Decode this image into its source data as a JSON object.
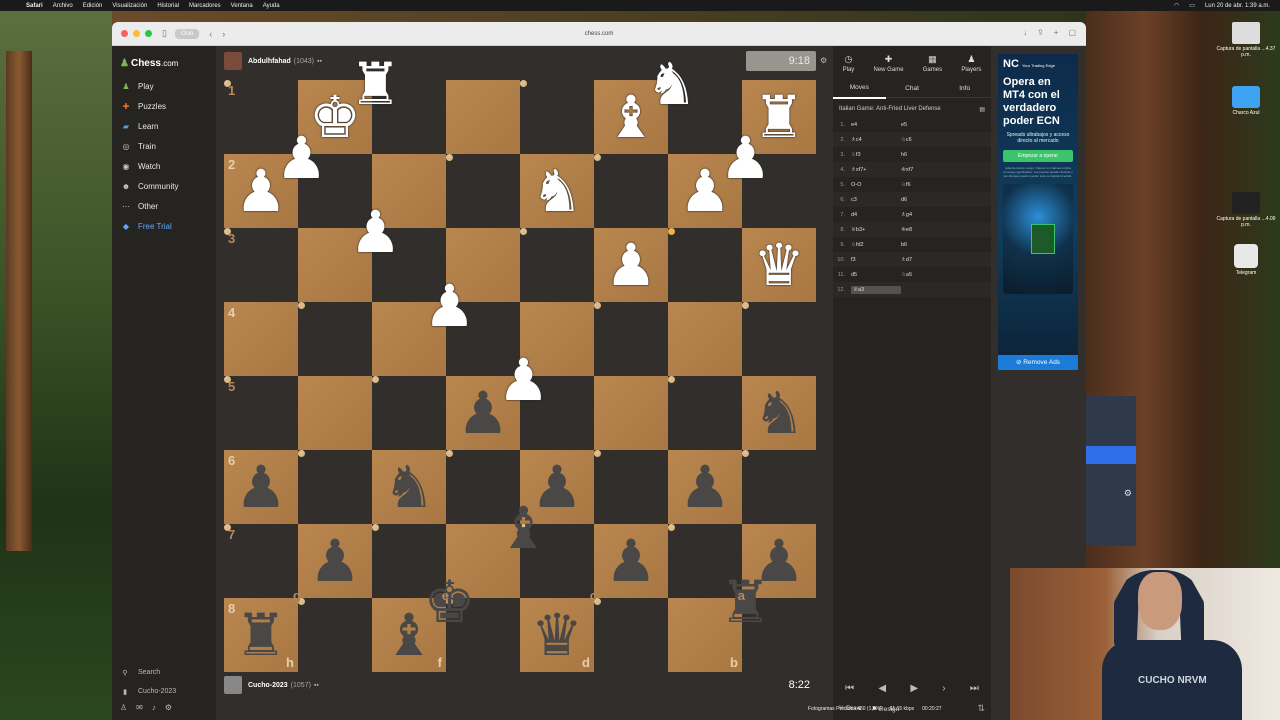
{
  "menubar": {
    "items": [
      "Safari",
      "Archivo",
      "Edición",
      "Visualización",
      "Historial",
      "Marcadores",
      "Ventana",
      "Ayuda"
    ],
    "clock": "Lun 20 de abr. 1:39 a.m."
  },
  "browser": {
    "tab_label": "Ocio",
    "url": "chess.com"
  },
  "sidebar": {
    "logo_main": "Chess",
    "logo_suffix": ".com",
    "items": [
      {
        "label": "Play",
        "icon": "play-icon"
      },
      {
        "label": "Puzzles",
        "icon": "puzzle-icon"
      },
      {
        "label": "Learn",
        "icon": "learn-icon"
      },
      {
        "label": "Train",
        "icon": "train-icon"
      },
      {
        "label": "Watch",
        "icon": "watch-icon"
      },
      {
        "label": "Community",
        "icon": "community-icon"
      },
      {
        "label": "Other",
        "icon": "more-icon"
      },
      {
        "label": "Free Trial",
        "icon": "diamond-icon"
      }
    ],
    "search_label": "Search",
    "user_label": "Cucho-2023"
  },
  "opponent": {
    "name": "Abdulhfahad",
    "rating": "(1043)",
    "clock": "9:18"
  },
  "player": {
    "name": "Cucho-2023",
    "rating": "(1057)",
    "clock": "8:22"
  },
  "board": {
    "ranks": [
      "1",
      "2",
      "3",
      "4",
      "5",
      "6",
      "7",
      "8"
    ],
    "files": [
      "h",
      "g",
      "f",
      "e",
      "d",
      "c",
      "b",
      "a"
    ],
    "highlight_squares": [
      "b3"
    ],
    "rows": [
      [
        "",
        "wK",
        "wR",
        "",
        "",
        "wB",
        "wN",
        "wR"
      ],
      [
        "wP",
        "wP",
        "",
        "",
        "wN",
        "",
        "wP",
        "wP"
      ],
      [
        "",
        "",
        "wP",
        "",
        "",
        "wP",
        "",
        "wQ"
      ],
      [
        "",
        "",
        "",
        "wP",
        "",
        "",
        "",
        ""
      ],
      [
        "",
        "",
        "",
        "bP",
        "wP",
        "",
        "",
        "bN"
      ],
      [
        "bP",
        "",
        "bN",
        "",
        "bP",
        "",
        "bP",
        ""
      ],
      [
        "",
        "bP",
        "",
        "",
        "bB",
        "bP",
        "",
        "bP"
      ],
      [
        "bR",
        "",
        "bB",
        "bK",
        "bQ",
        "",
        "",
        "bR"
      ]
    ]
  },
  "panel": {
    "top_tabs": [
      {
        "label": "Play",
        "icon": "play-clock-icon"
      },
      {
        "label": "New Game",
        "icon": "new-game-icon"
      },
      {
        "label": "Games",
        "icon": "games-icon"
      },
      {
        "label": "Players",
        "icon": "players-icon"
      }
    ],
    "sub_tabs": [
      "Moves",
      "Chat",
      "Info"
    ],
    "opening": "Italian Game: Anti-Fried Liver Defense",
    "moves": [
      {
        "n": "1.",
        "w": "e4",
        "b": "e5"
      },
      {
        "n": "2.",
        "w": "♗c4",
        "b": "♘c6"
      },
      {
        "n": "3.",
        "w": "♘f3",
        "b": "h6"
      },
      {
        "n": "4.",
        "w": "♗xf7+",
        "b": "♔xf7"
      },
      {
        "n": "5.",
        "w": "O-O",
        "b": "♘f6"
      },
      {
        "n": "6.",
        "w": "c3",
        "b": "d6"
      },
      {
        "n": "7.",
        "w": "d4",
        "b": "♗g4"
      },
      {
        "n": "8.",
        "w": "♕b3+",
        "b": "♔e8"
      },
      {
        "n": "9.",
        "w": "♘fd2",
        "b": "b6"
      },
      {
        "n": "10.",
        "w": "f3",
        "b": "♗d7"
      },
      {
        "n": "11.",
        "w": "d5",
        "b": "♘a5"
      },
      {
        "n": "12.",
        "w": "♕a3",
        "b": ""
      }
    ],
    "draw_label": "Draw",
    "resign_label": "Resign"
  },
  "ad": {
    "brand": "NC",
    "brand_sub": "Your Trading Edge",
    "headline": "Opera en MT4 con el verdadero poder ECN",
    "subtext": "Spreads ultrabajos y acceso directo al mercado",
    "cta": "Empezar a operar",
    "fine_print": "Advertencia de riesgo: Operar con valores implica un riesgo significativo. Los precios pueden fluctuar y los clientes pueden perder todo su capital invertido.",
    "remove_label": "Remove Ads"
  },
  "desktop": {
    "icons": [
      "Captura de pantalla ...4.37 p.m.",
      "Charco Azul",
      "Captura de pantalla ...4.09 p.m.",
      "Telegram"
    ]
  },
  "statusbar": {
    "items": [
      "Fotogramas Perdidos 450 (1.2%)",
      "61.15 kbps",
      "00:20:27"
    ]
  }
}
